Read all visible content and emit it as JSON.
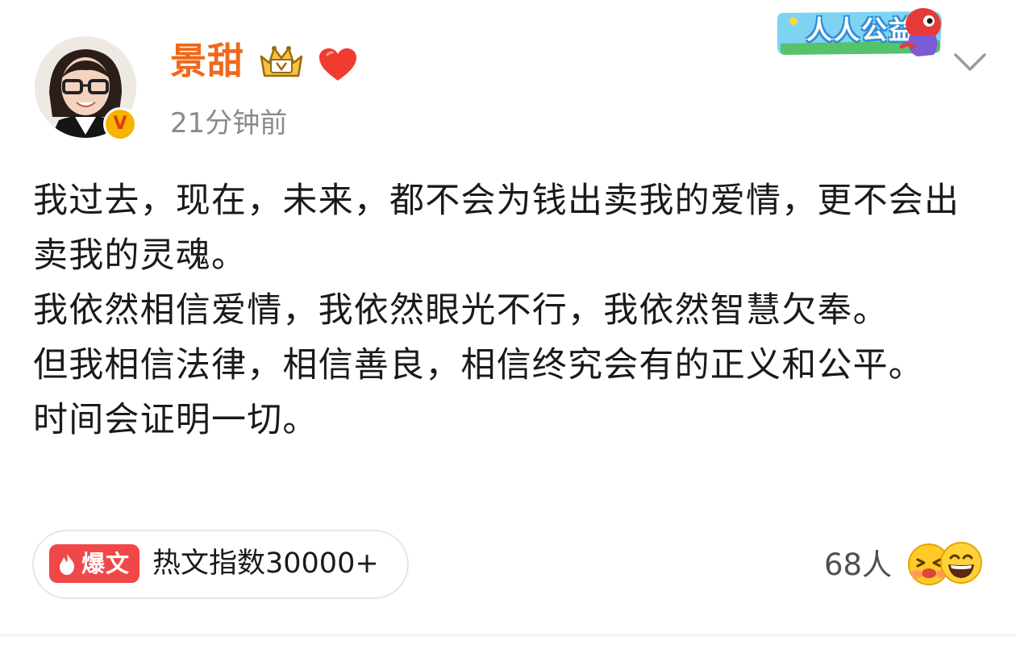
{
  "post": {
    "author": {
      "name": "景甜",
      "avatar": "avatar-photo",
      "badges": [
        "vip-crown-icon",
        "heart-icon",
        "verified-v-icon"
      ],
      "verified_mark": "V"
    },
    "timestamp": "21分钟前",
    "charity_banner": "人人公益",
    "body_lines": [
      "我过去，现在，未来，都不会为钱出卖我的爱情，更不会出卖我的灵魂。",
      "我依然相信爱情，我依然眼光不行，我依然智慧欠奉。",
      "但我相信法律，相信善良，相信终究会有的正义和公平。",
      "时间会证明一切。"
    ],
    "hot": {
      "tag_label": "爆文",
      "index_text": "热文指数30000+"
    },
    "reactions": {
      "count_text": "68人",
      "emojis": [
        "hug-emoji",
        "grin-emoji"
      ]
    }
  },
  "colors": {
    "username": "#f0681b",
    "hot_tag": "#f04848",
    "timestamp": "#8a8a8a",
    "charity": "#2f8ed6"
  }
}
